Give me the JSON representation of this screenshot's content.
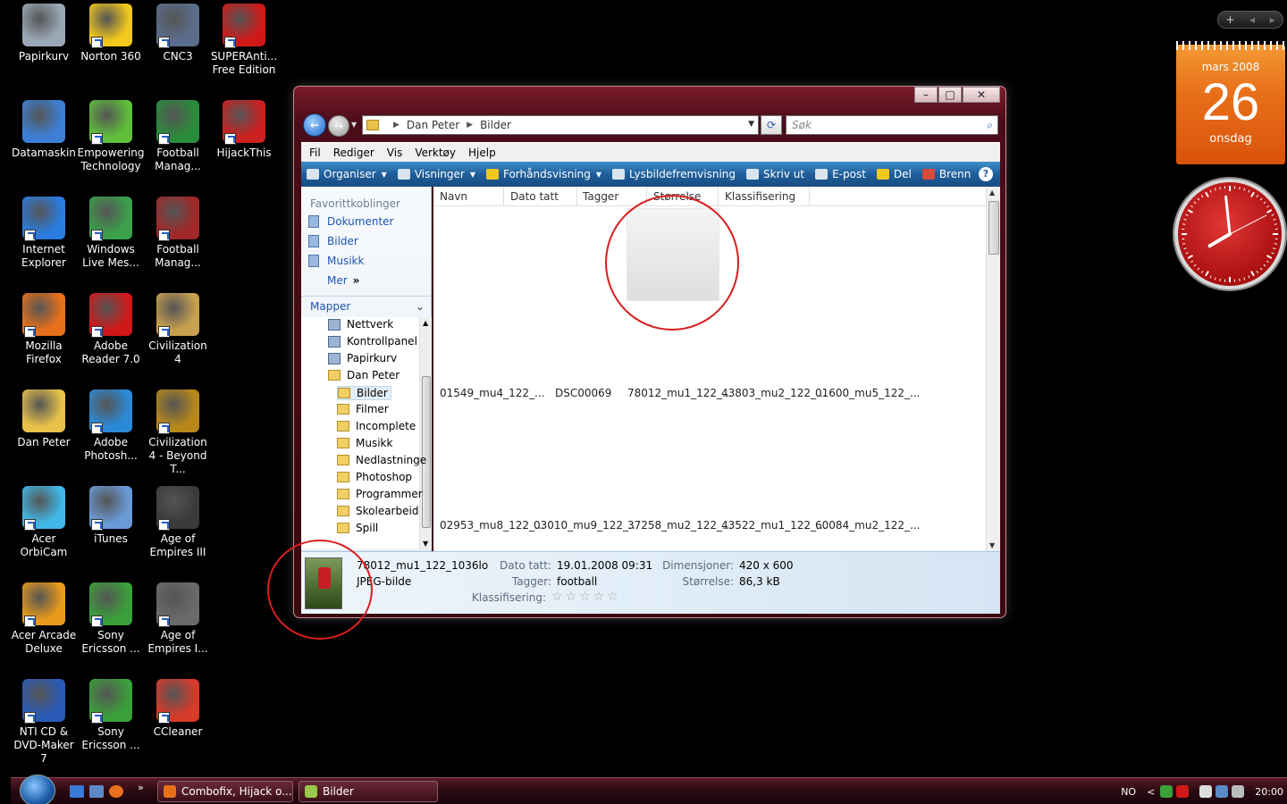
{
  "desktop_icons": [
    {
      "label": "Papirkurv",
      "color": "#9aa8b6"
    },
    {
      "label": "Norton 360",
      "color": "#f2c81c"
    },
    {
      "label": "CNC3",
      "color": "#5a6e8c"
    },
    {
      "label": "SUPERAnti... Free Edition",
      "color": "#d01818"
    },
    {
      "label": "Datamaskin",
      "color": "#3d7fd6"
    },
    {
      "label": "Empowering Technology",
      "color": "#5fbf3a"
    },
    {
      "label": "Football Manag...",
      "color": "#2a8c3a"
    },
    {
      "label": "HijackThis",
      "color": "#cc2020"
    },
    {
      "label": "Internet Explorer",
      "color": "#2a7ce0"
    },
    {
      "label": "Windows Live Mes...",
      "color": "#3aa04a"
    },
    {
      "label": "Football Manag...",
      "color": "#a02828"
    },
    {
      "label": "Mozilla Firefox",
      "color": "#e8701a"
    },
    {
      "label": "Adobe Reader 7.0",
      "color": "#d01818"
    },
    {
      "label": "Civilization 4",
      "color": "#c8a050"
    },
    {
      "label": "Dan Peter",
      "color": "#e8c24a"
    },
    {
      "label": "Adobe Photosh...",
      "color": "#2a8ad8"
    },
    {
      "label": "Civilization 4 - Beyond T...",
      "color": "#b8881a"
    },
    {
      "label": "Acer OrbiCam",
      "color": "#40b8e8"
    },
    {
      "label": "iTunes",
      "color": "#6a9ad8"
    },
    {
      "label": "Age of Empires III",
      "color": "#3a3a3a"
    },
    {
      "label": "Acer Arcade Deluxe",
      "color": "#e89a1a"
    },
    {
      "label": "Sony Ericsson ...",
      "color": "#3aa03a"
    },
    {
      "label": "Age of Empires I...",
      "color": "#6a6a6a"
    },
    {
      "label": "NTI CD & DVD-Maker 7",
      "color": "#2a5ab8"
    },
    {
      "label": "Sony Ericsson ...",
      "color": "#3aa03a"
    },
    {
      "label": "CCleaner",
      "color": "#d83a2a"
    }
  ],
  "window": {
    "breadcrumb": [
      "Dan Peter",
      "Bilder"
    ],
    "search_placeholder": "Søk",
    "menu": [
      "Fil",
      "Rediger",
      "Vis",
      "Verktøy",
      "Hjelp"
    ],
    "commands": [
      {
        "label": "Organiser",
        "has_arrow": true,
        "icon_color": "#d8e4f0"
      },
      {
        "label": "Visninger",
        "has_arrow": true,
        "icon_color": "#d8e4f0"
      },
      {
        "label": "Forhåndsvisning",
        "has_arrow": true,
        "icon_color": "#f2c81c"
      },
      {
        "label": "Lysbildefremvisning",
        "has_arrow": false,
        "icon_color": "#d8e4f0"
      },
      {
        "label": "Skriv ut",
        "has_arrow": false,
        "icon_color": "#d8e4f0"
      },
      {
        "label": "E-post",
        "has_arrow": false,
        "icon_color": "#d8e4f0"
      },
      {
        "label": "Del",
        "has_arrow": false,
        "icon_color": "#f2c81c"
      },
      {
        "label": "Brenn",
        "has_arrow": false,
        "icon_color": "#d84a3a"
      }
    ],
    "help_label": "?",
    "favorites_title": "Favorittkoblinger",
    "favorites": [
      "Dokumenter",
      "Bilder",
      "Musikk",
      "Mer"
    ],
    "more_arrow": "»",
    "folders_title": "Mapper",
    "tree": [
      {
        "label": "Nettverk",
        "type": "sys"
      },
      {
        "label": "Kontrollpanel",
        "type": "sys"
      },
      {
        "label": "Papirkurv",
        "type": "sys"
      },
      {
        "label": "Dan Peter",
        "type": "folder"
      },
      {
        "label": "Bilder",
        "type": "folder",
        "selected": true
      },
      {
        "label": "Filmer",
        "type": "folder"
      },
      {
        "label": "Incomplete",
        "type": "folder"
      },
      {
        "label": "Musikk",
        "type": "folder"
      },
      {
        "label": "Nedlastninge",
        "type": "folder"
      },
      {
        "label": "Photoshop",
        "type": "folder"
      },
      {
        "label": "Programmer",
        "type": "folder"
      },
      {
        "label": "Skolearbeid",
        "type": "folder"
      },
      {
        "label": "Spill",
        "type": "folder"
      }
    ],
    "columns": [
      "Navn",
      "Dato tatt",
      "Tagger",
      "Størrelse",
      "Klassifisering"
    ],
    "files_row1": [
      "01549_mu4_122_...",
      "DSC00069",
      "78012_mu1_122_...",
      "43803_mu2_122_...",
      "01600_mu5_122_..."
    ],
    "files_row2": [
      "02953_mu8_122_...",
      "03010_mu9_122_...",
      "37258_mu2_122_...",
      "43522_mu1_122_...",
      "60084_mu2_122_..."
    ],
    "details": {
      "name": "78012_mu1_122_1036lo",
      "type": "JPEG-bilde",
      "date_label": "Dato tatt:",
      "date_value": "19.01.2008 09:31",
      "tags_label": "Tagger:",
      "tags_value": "football",
      "rating_label": "Klassifisering:",
      "rating_stars": 0,
      "dim_label": "Dimensjoner:",
      "dim_value": "420 x 600",
      "size_label": "Størrelse:",
      "size_value": "86,3 kB"
    }
  },
  "sidebar": {
    "add_label": "+",
    "calendar": {
      "month": "mars 2008",
      "day": "26",
      "weekday": "onsdag"
    },
    "clock": {
      "hour": 7,
      "minute": 59
    }
  },
  "taskbar": {
    "buttons": [
      {
        "label": "Combofix, Hijack o...",
        "icon_color": "#e8701a"
      },
      {
        "label": "Bilder",
        "icon_color": "#9ac84a"
      }
    ],
    "more_arrow": "»",
    "lang": "NO",
    "tray_arrow": "<",
    "time": "20:00"
  }
}
